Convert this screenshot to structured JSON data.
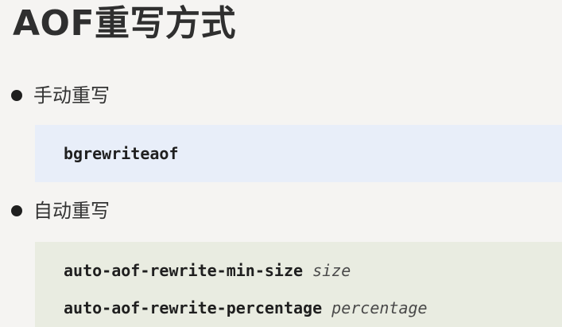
{
  "title": "AOF重写方式",
  "items": [
    {
      "label": "手动重写",
      "code_lines": [
        {
          "cmd": "bgrewriteaof",
          "arg": ""
        }
      ]
    },
    {
      "label": "自动重写",
      "code_lines": [
        {
          "cmd": "auto-aof-rewrite-min-size",
          "arg": "size"
        },
        {
          "cmd": "auto-aof-rewrite-percentage",
          "arg": "percentage"
        }
      ]
    }
  ],
  "colors": {
    "background": "#f5f4f2",
    "manual_code_bg": "#e8eef9",
    "auto_code_bg": "#e9ece1",
    "text": "#2f2f2f"
  }
}
